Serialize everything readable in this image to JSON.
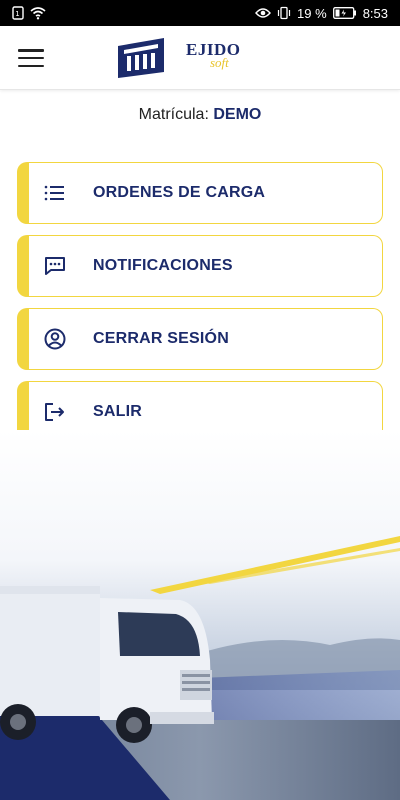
{
  "status_bar": {
    "battery_percent": "19 %",
    "time": "8:53"
  },
  "app_bar": {
    "logo_main": "EJIDO",
    "logo_sub": "soft"
  },
  "plate": {
    "label": "Matrícula:",
    "value": "DEMO"
  },
  "menu": {
    "items": [
      {
        "label": "ORDENES DE CARGA",
        "icon": "list-icon"
      },
      {
        "label": "NOTIFICACIONES",
        "icon": "chat-icon"
      },
      {
        "label": "CERRAR SESIÓN",
        "icon": "user-circle-icon"
      },
      {
        "label": "SALIR",
        "icon": "exit-icon"
      }
    ]
  },
  "colors": {
    "accent_yellow": "#f2d640",
    "brand_blue": "#1c2b6b"
  }
}
